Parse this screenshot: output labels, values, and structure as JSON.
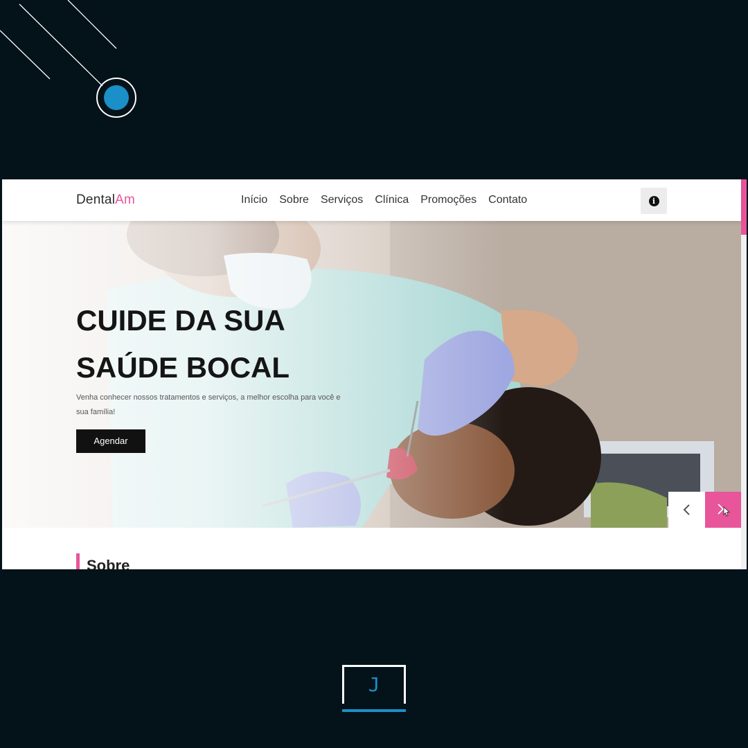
{
  "colors": {
    "background": "#04121a",
    "accent_pink": "#e8559a",
    "accent_blue": "#1b8fc7",
    "button_dark": "#111111"
  },
  "navbar": {
    "logo_main": "Dental",
    "logo_accent": "Am",
    "links": [
      "Início",
      "Sobre",
      "Serviços",
      "Clínica",
      "Promoções",
      "Contato"
    ],
    "info_icon": "info-icon"
  },
  "hero": {
    "title_line1": "CUIDE DA SUA",
    "title_line2": "SAÚDE BOCAL",
    "subtitle": "Venha conhecer nossos tratamentos e serviços, a melhor escolha para você e sua família!",
    "cta_label": "Agendar",
    "prev_icon": "chevron-left-icon",
    "next_icon": "chevron-right-icon"
  },
  "about": {
    "title": "Sobre"
  },
  "brand_mark": {
    "letter": "J"
  }
}
